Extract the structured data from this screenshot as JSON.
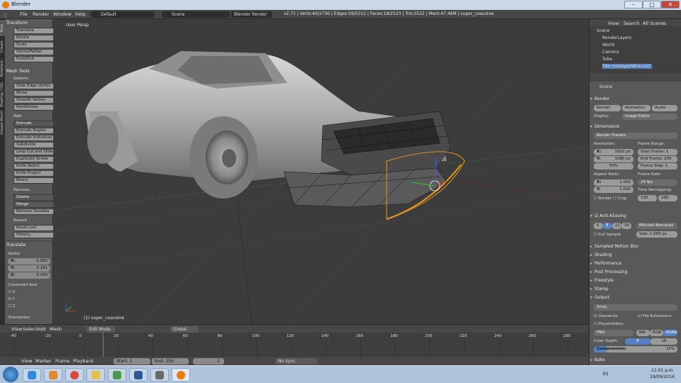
{
  "window": {
    "title": "Blender",
    "min": "–",
    "max": "□",
    "close": "✕"
  },
  "menu": {
    "file": "File",
    "render": "Render",
    "window": "Window",
    "help": "Help",
    "layout": "Default",
    "scene": "Scene",
    "engine": "Blender Render",
    "stats": "v2.71 | Verts:40/2736 | Edges:59/5312 | Faces:18/2523 | Tris:5522 | Mem:47.46M | super_coacoine"
  },
  "toolshelf": {
    "tabs": [
      "Tools",
      "Create",
      "Relations",
      "Shading / UVs",
      "Grease Pencil"
    ],
    "transform": {
      "header": "Transform",
      "items": [
        "Translate",
        "Rotate",
        "Scale",
        "Shrink/Fatten",
        "Push/Pull"
      ]
    },
    "mesh_tools": {
      "header": "Mesh Tools",
      "deform": "Deform:",
      "items": [
        "Slide Edge   Vertex",
        "Noise",
        "Smooth Vertex",
        "Randomize"
      ],
      "add": "Add:",
      "extrude": "Extrude",
      "add_items": [
        "Extrude Region",
        "Extrude Individual",
        "Subdivide",
        "Loop Cut and Slide",
        "Duplicate   Screw",
        "Knife   Select",
        "Knife Project",
        "Bisect"
      ],
      "remove": "Remove:",
      "remove_items": [
        "Delete",
        "Merge"
      ],
      "remove_doubles": "Remove Doubles",
      "recent": "Recent",
      "recent_items": [
        "Reset Last",
        "History..."
      ]
    },
    "translate": {
      "header": "Translate",
      "vector": "Vector",
      "x": "X:",
      "xv": "0.000",
      "y": "Y:",
      "yv": "0.181",
      "z": "Z:",
      "zv": "0.000",
      "constraint": "Constraint Axis",
      "cx": "X",
      "cy": "Y",
      "cz": "Z",
      "orientation": "Orientation"
    }
  },
  "viewport": {
    "label": "User Persp",
    "object": "(1) super_coacoine"
  },
  "vp_header": {
    "view": "View",
    "select": "Select",
    "add": "Add",
    "mesh": "Mesh",
    "mode": "Edit Mode",
    "global": "Global"
  },
  "timeline": {
    "ticks": [
      "-40",
      "-20",
      "0",
      "20",
      "40",
      "60",
      "80",
      "100",
      "120",
      "140",
      "160",
      "180",
      "200",
      "220",
      "240",
      "260",
      "280"
    ],
    "view": "View",
    "marker": "Marker",
    "frame": "Frame",
    "playback": "Playback",
    "start": "Start:",
    "start_v": "1",
    "end": "End:",
    "end_v": "250",
    "current": "1",
    "sync": "No Sync"
  },
  "outliner": {
    "view": "View",
    "search": "Search",
    "all": "All Scenes",
    "rows": [
      "Scene",
      "RenderLayers",
      "World",
      "Camera",
      "Tube",
      "Tito moneyexWire.unit"
    ]
  },
  "props": {
    "scene": "Scene",
    "render": "Render",
    "render_btn": "Render",
    "anim_btn": "Animation",
    "audio_btn": "Audio",
    "display": "Display:",
    "display_v": "Image Editor",
    "dimensions": "Dimensions",
    "preset": "Render Presets",
    "resolution": "Resolution:",
    "res_x": "X:",
    "res_x_v": "1920 px",
    "res_y": "Y:",
    "res_y_v": "1080 px",
    "res_pct": "50%",
    "frame_range": "Frame Range:",
    "start_f": "Start Frame: 1",
    "end_f": "End Frame: 250",
    "step": "Frame Step: 1",
    "aspect": "Aspect Ratio:",
    "ax": "X:",
    "ax_v": "1.000",
    "ay": "Y:",
    "ay_v": "1.000",
    "frame_rate": "Frame Rate:",
    "fps": "24 fps",
    "time_remap": "Time Remapping:",
    "remap_old": "100",
    "remap_new": "100",
    "border": "Border",
    "crop": "Crop",
    "aa": "Anti-Aliasing",
    "aa_vals": [
      "5",
      "8",
      "11",
      "16"
    ],
    "filter": "Mitchell-Netravali",
    "full_sample": "Full Sample",
    "size": "Size: 1.000 px",
    "sections": [
      "Sampled Motion Blur",
      "Shading",
      "Performance",
      "Post Processing",
      "Freestyle",
      "Stamp"
    ],
    "output": "Output",
    "path": "/tmp\\",
    "overwrite": "Overwrite",
    "file_ext": "File Extensions",
    "placeholders": "Placeholders",
    "format": "PNG",
    "bw": "BW",
    "rgb": "RGB",
    "rgba": "RGBA",
    "depth": "Color Depth:",
    "d8": "8",
    "d16": "16",
    "compression": "Compression:",
    "comp_v": "15%",
    "bake": "Bake"
  },
  "taskbar": {
    "lang": "ES",
    "time": "11:01 p.m.",
    "date": "19/09/2014"
  },
  "colors": {
    "orange": "#e8961e",
    "select_blue": "#5680c2",
    "bg": "#3c3c3c"
  }
}
